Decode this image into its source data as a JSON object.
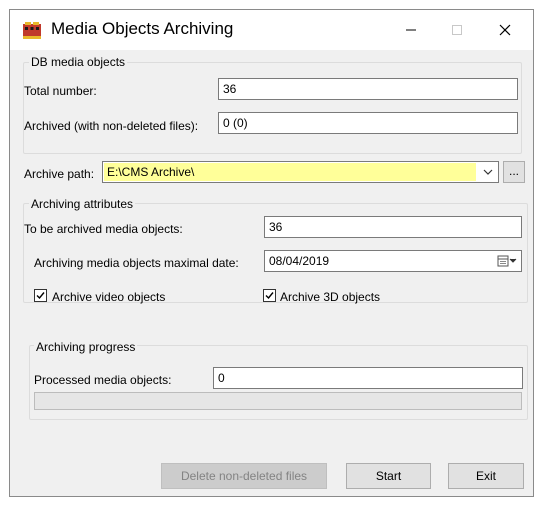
{
  "window": {
    "title": "Media Objects Archiving"
  },
  "db_media": {
    "group_title": "DB media objects",
    "total_label": "Total number:",
    "total_value": "36",
    "archived_label": "Archived (with non-deleted files):",
    "archived_value": "0 (0)"
  },
  "archive_path": {
    "label": "Archive path:",
    "value": "E:\\CMS Archive\\",
    "browse_label": "..."
  },
  "attributes": {
    "group_title": "Archiving attributes",
    "to_archive_label": "To be archived media objects:",
    "to_archive_value": "36",
    "max_date_label": "Archiving media objects maximal date:",
    "max_date_value": "08/04/2019",
    "video_label": "Archive video objects",
    "video_checked": true,
    "objects3d_label": "Archive 3D objects",
    "objects3d_checked": true
  },
  "progress": {
    "group_title": "Archiving progress",
    "processed_label": "Processed media objects:",
    "processed_value": "0",
    "fraction": 0
  },
  "buttons": {
    "delete_label": "Delete non-deleted files",
    "start_label": "Start",
    "exit_label": "Exit"
  }
}
